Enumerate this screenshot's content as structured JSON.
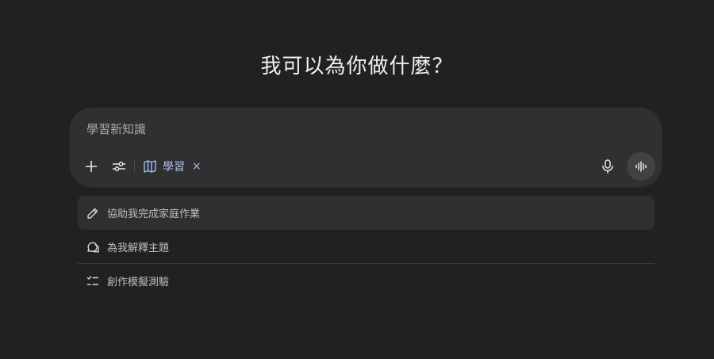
{
  "heading": "我可以為你做什麼？",
  "composer": {
    "placeholder": "學習新知識",
    "chip_label": "學習",
    "chip_close": "×",
    "icons": [
      "plus-icon",
      "sliders-icon",
      "book-icon",
      "microphone-icon",
      "voice-waveform-icon"
    ]
  },
  "suggestions": [
    {
      "label": "協助我完成家庭作業",
      "icon": "pencil-icon"
    },
    {
      "label": "為我解釋主題",
      "icon": "speech-bubble-icon"
    },
    {
      "label": "創作模擬測驗",
      "icon": "checklist-icon"
    }
  ],
  "colors": {
    "background": "#212121",
    "composer": "#303030",
    "chip_accent": "#9ec2f7"
  }
}
